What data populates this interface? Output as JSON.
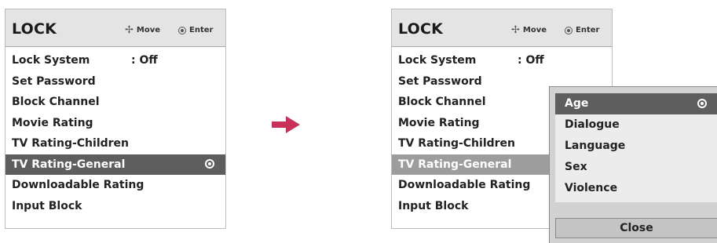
{
  "left_panel": {
    "title": "LOCK",
    "hint_move": "Move",
    "hint_enter": "Enter",
    "items": [
      {
        "label": "Lock System",
        "value": ": Off"
      },
      {
        "label": "Set Password"
      },
      {
        "label": "Block Channel"
      },
      {
        "label": "Movie Rating"
      },
      {
        "label": "TV Rating-Children"
      },
      {
        "label": "TV Rating-General",
        "selected": true
      },
      {
        "label": "Downloadable Rating"
      },
      {
        "label": "Input Block"
      }
    ]
  },
  "right_panel": {
    "title": "LOCK",
    "hint_move": "Move",
    "hint_enter": "Enter",
    "items": [
      {
        "label": "Lock System",
        "value": ": Off"
      },
      {
        "label": "Set Password"
      },
      {
        "label": "Block Channel"
      },
      {
        "label": "Movie Rating"
      },
      {
        "label": "TV Rating-Children"
      },
      {
        "label": "TV Rating-General",
        "selected": true
      },
      {
        "label": "Downloadable Rating"
      },
      {
        "label": "Input Block"
      }
    ]
  },
  "popup": {
    "items": [
      {
        "label": "Age",
        "selected": true
      },
      {
        "label": "Dialogue"
      },
      {
        "label": "Language"
      },
      {
        "label": "Sex"
      },
      {
        "label": "Violence"
      }
    ],
    "close_label": "Close"
  },
  "colors": {
    "header_bg": "#e4e4e4",
    "selected_bg": "#5e5e5e",
    "selected_inactive_bg": "#9d9d9d",
    "arrow": "#c8325a"
  },
  "icons": {
    "move": "four-way-arrow-icon",
    "enter": "enter-circle-icon",
    "transition": "right-arrow-icon"
  }
}
